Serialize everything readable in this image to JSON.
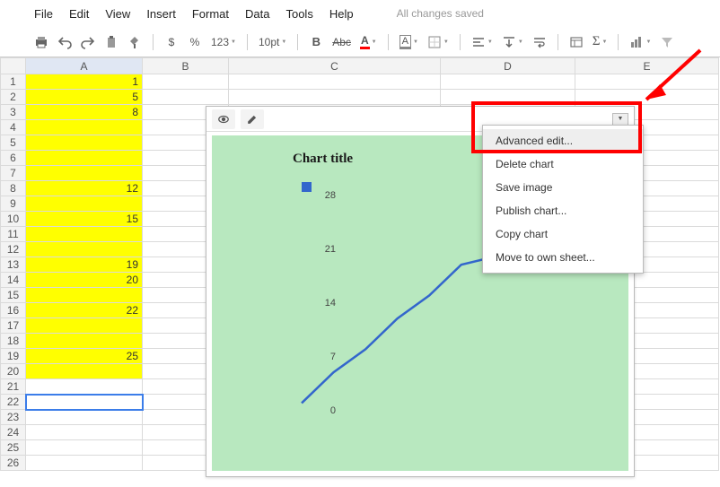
{
  "menubar": {
    "items": [
      "File",
      "Edit",
      "View",
      "Insert",
      "Format",
      "Data",
      "Tools",
      "Help"
    ],
    "saved": "All changes saved"
  },
  "toolbar": {
    "dollar": "$",
    "percent": "%",
    "numfmt": "123",
    "font_size": "10pt",
    "bold": "B",
    "strike": "Abc",
    "textcolor": "A",
    "fillcolor": "A"
  },
  "columns": [
    "A",
    "B",
    "C",
    "D",
    "E"
  ],
  "rows": [
    {
      "n": 1,
      "a": "1"
    },
    {
      "n": 2,
      "a": "5"
    },
    {
      "n": 3,
      "a": "8"
    },
    {
      "n": 4,
      "a": ""
    },
    {
      "n": 5,
      "a": ""
    },
    {
      "n": 6,
      "a": ""
    },
    {
      "n": 7,
      "a": ""
    },
    {
      "n": 8,
      "a": "12"
    },
    {
      "n": 9,
      "a": ""
    },
    {
      "n": 10,
      "a": "15"
    },
    {
      "n": 11,
      "a": ""
    },
    {
      "n": 12,
      "a": ""
    },
    {
      "n": 13,
      "a": "19"
    },
    {
      "n": 14,
      "a": "20"
    },
    {
      "n": 15,
      "a": ""
    },
    {
      "n": 16,
      "a": "22"
    },
    {
      "n": 17,
      "a": ""
    },
    {
      "n": 18,
      "a": ""
    },
    {
      "n": 19,
      "a": "25"
    },
    {
      "n": 20,
      "a": ""
    },
    {
      "n": 21,
      "a": "",
      "blank": true
    },
    {
      "n": 22,
      "a": "",
      "blank": true,
      "selected": true
    },
    {
      "n": 23,
      "a": "",
      "blank": true
    },
    {
      "n": 24,
      "a": "",
      "blank": true
    },
    {
      "n": 25,
      "a": "",
      "blank": true
    },
    {
      "n": 26,
      "a": "",
      "blank": true
    }
  ],
  "chart": {
    "title": "Chart title",
    "yticks": [
      0,
      7,
      14,
      21,
      28
    ]
  },
  "context_menu": {
    "items": [
      "Advanced edit...",
      "Delete chart",
      "Save image",
      "Publish chart...",
      "Copy chart",
      "Move to own sheet..."
    ],
    "highlight_index": 0
  },
  "chart_data": {
    "type": "line",
    "title": "Chart title",
    "xlabel": "",
    "ylabel": "",
    "ylim": [
      0,
      28
    ],
    "yticks": [
      0,
      7,
      14,
      21,
      28
    ],
    "x": [
      1,
      2,
      3,
      4,
      5,
      6,
      7,
      8,
      9,
      10
    ],
    "values": [
      1,
      5,
      8,
      12,
      15,
      19,
      20,
      22,
      25,
      25
    ],
    "series": [
      {
        "name": "",
        "color": "#3366cc",
        "values": [
          1,
          5,
          8,
          12,
          15,
          19,
          20,
          22,
          25,
          25
        ]
      }
    ]
  }
}
